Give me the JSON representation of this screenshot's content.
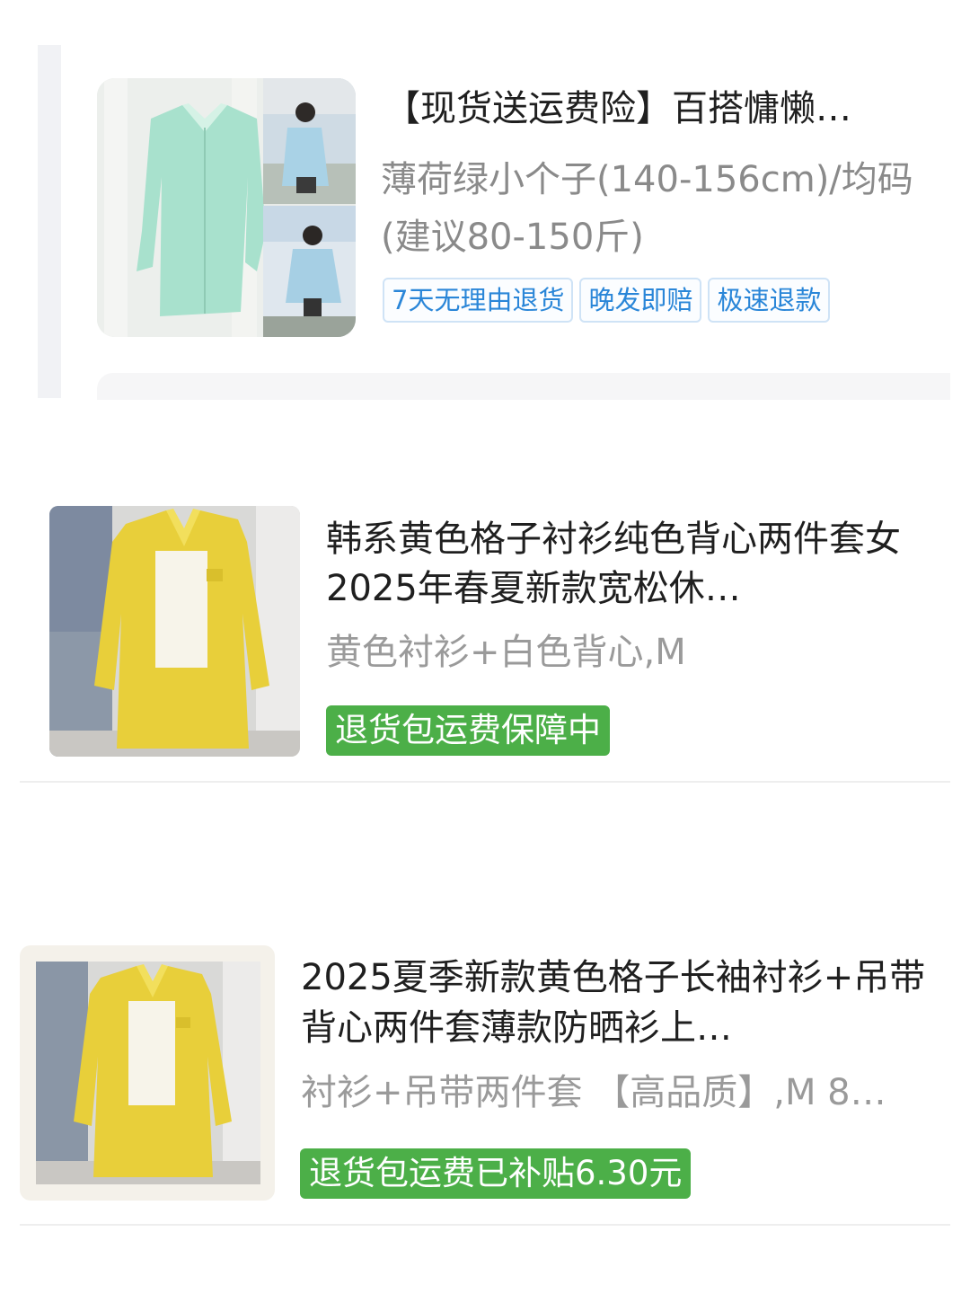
{
  "orders": [
    {
      "title": "【现货送运费险】百搭慵懒…",
      "spec": "薄荷绿小个子(140-156cm)/均码(建议80-150斤)",
      "tags": [
        "7天无理由退货",
        "晚发即赔",
        "极速退款"
      ],
      "thumbnail": "mint-green-shirt-photo"
    },
    {
      "title": "韩系黄色格子衬衫纯色背心两件套女2025年春夏新款宽松休…",
      "spec": "黄色衬衫+白色背心,M",
      "badge": "退货包运费保障中",
      "thumbnail": "yellow-plaid-shirt-photo"
    },
    {
      "title": "2025夏季新款黄色格子长袖衬衫+吊带背心两件套薄款防晒衫上…",
      "spec": "衬衫+吊带两件套 【高品质】,M 8…",
      "badge": "退货包运费已补贴6.30元",
      "thumbnail": "yellow-plaid-shirt-photo"
    }
  ],
  "colors": {
    "badge_green": "#4caf48",
    "tag_blue": "#2a86d8",
    "tag_border": "#cfe3f6",
    "title": "#1f1f1f",
    "spec": "#8a8a8a"
  }
}
